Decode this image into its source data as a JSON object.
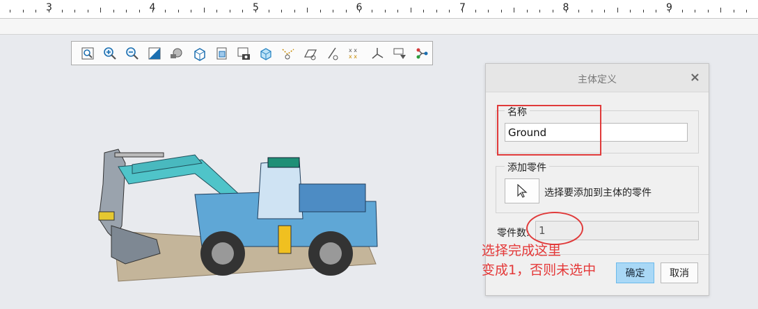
{
  "ruler": {
    "labels": [
      "3",
      "4",
      "5",
      "6",
      "7",
      "8",
      "9"
    ]
  },
  "toolbar": {
    "icons": [
      "zoom-fit-icon",
      "zoom-in-icon",
      "zoom-out-icon",
      "zoom-area-icon",
      "render-style-icon",
      "box-view-icon",
      "view-orient-icon",
      "screenshot-icon",
      "transparent-icon",
      "constraint-icon",
      "plane-icon",
      "hide-line-icon",
      "points-icon",
      "axis-icon",
      "display-filter-icon",
      "connect-icon"
    ]
  },
  "dialog": {
    "title": "主体定义",
    "close_glyph": "×",
    "name_group_label": "名称",
    "name_value": "Ground",
    "add_group_label": "添加零件",
    "add_hint": "选择要添加到主体的零件",
    "count_label": "零件数:",
    "count_value": "1",
    "ok_label": "确定",
    "cancel_label": "取消"
  },
  "annotation": {
    "line1": "选择完成这里",
    "line2": "变成1，否则未选中",
    "color": "#e43838"
  }
}
